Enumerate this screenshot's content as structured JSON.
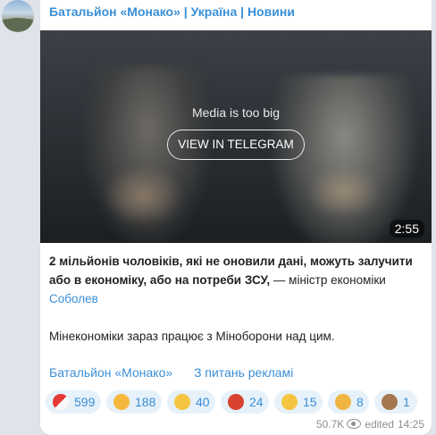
{
  "channel": {
    "name": "Батальйон «Монако» | Україна | Новини"
  },
  "media": {
    "note": "Media is too big",
    "button_label": "VIEW IN TELEGRAM",
    "duration": "2:55"
  },
  "post": {
    "p1_bold": "2 мільйонів чоловіків, які не оновили дані, можуть залучити або в економіку, або на потреби ЗСУ,",
    "p1_rest": " — міністр економіки ",
    "p1_link": "Соболев",
    "p2": "Мінекономіки зараз працює з Міноборони над цим."
  },
  "links": {
    "channel_link": "Батальйон «Монако»",
    "ads_link": "З питань рекламі"
  },
  "reactions": [
    {
      "icon": "pill-icon",
      "count": "599",
      "color": "#e53935"
    },
    {
      "icon": "thumbs-up-icon",
      "count": "188",
      "color": "#f5b83d"
    },
    {
      "icon": "thinking-face-icon",
      "count": "40",
      "color": "#f5c542"
    },
    {
      "icon": "angry-face-icon",
      "count": "24",
      "color": "#d8432f"
    },
    {
      "icon": "woozy-face-icon",
      "count": "15",
      "color": "#f5c542"
    },
    {
      "icon": "praying-hands-icon",
      "count": "8",
      "color": "#f0b441"
    },
    {
      "icon": "see-no-evil-monkey-icon",
      "count": "1",
      "color": "#a5774f"
    }
  ],
  "footer": {
    "views": "50.7K",
    "edited": "edited",
    "time": "14:25"
  },
  "colors": {
    "accent": "#3a8fd6",
    "background": "#dfe4ea",
    "bubble": "#ffffff"
  }
}
